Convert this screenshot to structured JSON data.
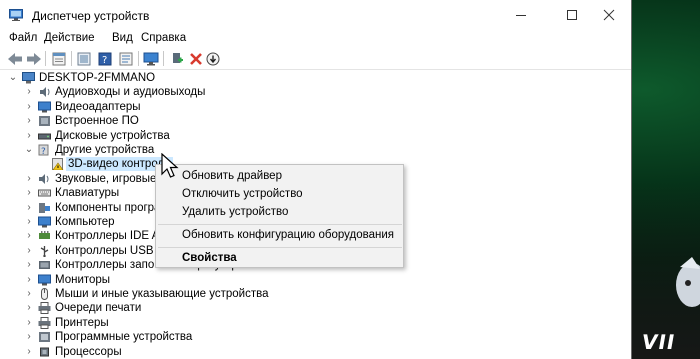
{
  "window": {
    "title": "Диспетчер устройств"
  },
  "menu": {
    "file": "Файл",
    "action": "Действие",
    "view": "Вид",
    "help": "Справка"
  },
  "toolbar": {
    "icons": [
      "back-arrow-icon",
      "forward-arrow-icon",
      "properties-icon",
      "update-driver-icon",
      "help-icon",
      "scan-hardware-icon",
      "monitor-icon",
      "add-device-icon",
      "uninstall-red-x-icon",
      "disable-device-down-icon"
    ]
  },
  "tree": {
    "root": "DESKTOP-2FMMANO",
    "items": [
      {
        "label": "Аудиовходы и аудиовыходы",
        "icon": "audio-io-icon",
        "expanded": false
      },
      {
        "label": "Видеоадаптеры",
        "icon": "display-adapter-icon",
        "expanded": false
      },
      {
        "label": "Встроенное ПО",
        "icon": "firmware-icon",
        "expanded": false
      },
      {
        "label": "Дисковые устройства",
        "icon": "disk-drive-icon",
        "expanded": false
      },
      {
        "label": "Другие устройства",
        "icon": "other-devices-icon",
        "expanded": true
      },
      {
        "label": "3D-видео контролл",
        "icon": "unknown-device-warning-icon",
        "child": true,
        "selected": true
      },
      {
        "label": "Звуковые, игровые и ви",
        "icon": "sound-icon",
        "expanded": false
      },
      {
        "label": "Клавиатуры",
        "icon": "keyboard-icon",
        "expanded": false
      },
      {
        "label": "Компоненты программ",
        "icon": "software-components-icon",
        "expanded": false
      },
      {
        "label": "Компьютер",
        "icon": "computer-icon",
        "expanded": false
      },
      {
        "label": "Контроллеры IDE ATA/A",
        "icon": "ide-controller-icon",
        "expanded": false
      },
      {
        "label": "Контроллеры USB",
        "icon": "usb-controller-icon",
        "expanded": false
      },
      {
        "label": "Контроллеры запоминающих устройств",
        "icon": "storage-controller-icon",
        "expanded": false
      },
      {
        "label": "Мониторы",
        "icon": "monitor-icon",
        "expanded": false
      },
      {
        "label": "Мыши и иные указывающие устройства",
        "icon": "mouse-icon",
        "expanded": false
      },
      {
        "label": "Очереди печати",
        "icon": "print-queue-icon",
        "expanded": false
      },
      {
        "label": "Принтеры",
        "icon": "printer-icon",
        "expanded": false
      },
      {
        "label": "Программные устройства",
        "icon": "software-device-icon",
        "expanded": false
      },
      {
        "label": "Процессоры",
        "icon": "processor-icon",
        "expanded": false
      }
    ]
  },
  "context_menu": {
    "update_driver": "Обновить драйвер",
    "disable_device": "Отключить устройство",
    "uninstall_device": "Удалить устройство",
    "scan_hardware": "Обновить конфигурацию оборудования",
    "properties": "Свойства"
  },
  "colors": {
    "selection": "#cce8ff",
    "menu_bg": "#f2f2f2",
    "close_x": "#d83a2e",
    "accent_green": "#0e5a2c"
  }
}
